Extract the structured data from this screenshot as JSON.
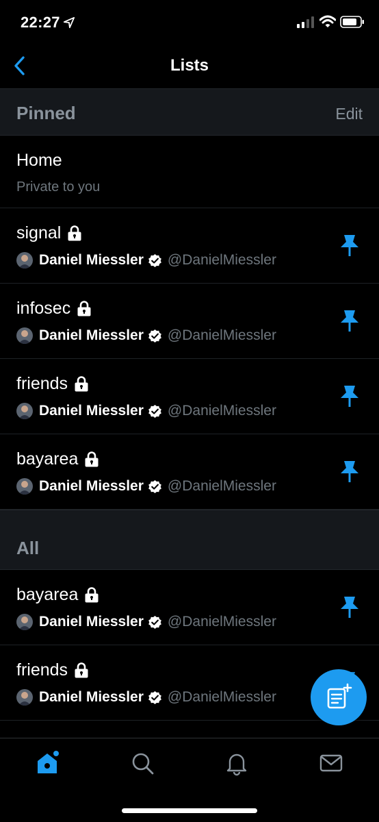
{
  "status_bar": {
    "time": "22:27",
    "icons": [
      "location-arrow-icon",
      "cellular-signal-icon",
      "wifi-icon",
      "battery-icon"
    ]
  },
  "nav": {
    "title": "Lists",
    "back_icon": "chevron-left-icon"
  },
  "pinned": {
    "title": "Pinned",
    "edit_label": "Edit",
    "home": {
      "title": "Home",
      "subtitle": "Private to you"
    },
    "lists": [
      {
        "name": "signal",
        "owner": "Daniel Miessler",
        "handle": "@DanielMiessler"
      },
      {
        "name": "infosec",
        "owner": "Daniel Miessler",
        "handle": "@DanielMiessler"
      },
      {
        "name": "friends",
        "owner": "Daniel Miessler",
        "handle": "@DanielMiessler"
      },
      {
        "name": "bayarea",
        "owner": "Daniel Miessler",
        "handle": "@DanielMiessler"
      }
    ]
  },
  "all": {
    "title": "All",
    "lists": [
      {
        "name": "bayarea",
        "owner": "Daniel Miessler",
        "handle": "@DanielMiessler",
        "pinned": true
      },
      {
        "name": "friends",
        "owner": "Daniel Miessler",
        "handle": "@DanielMiessler",
        "pinned": true
      }
    ]
  },
  "fab_icon": "new-list-icon",
  "tabs": [
    "home-icon",
    "search-icon",
    "notifications-bell-icon",
    "messages-envelope-icon"
  ],
  "colors": {
    "accent": "#1d9bf0",
    "background": "#000000",
    "section_background": "#15181c",
    "muted_text": "#6e767d"
  }
}
